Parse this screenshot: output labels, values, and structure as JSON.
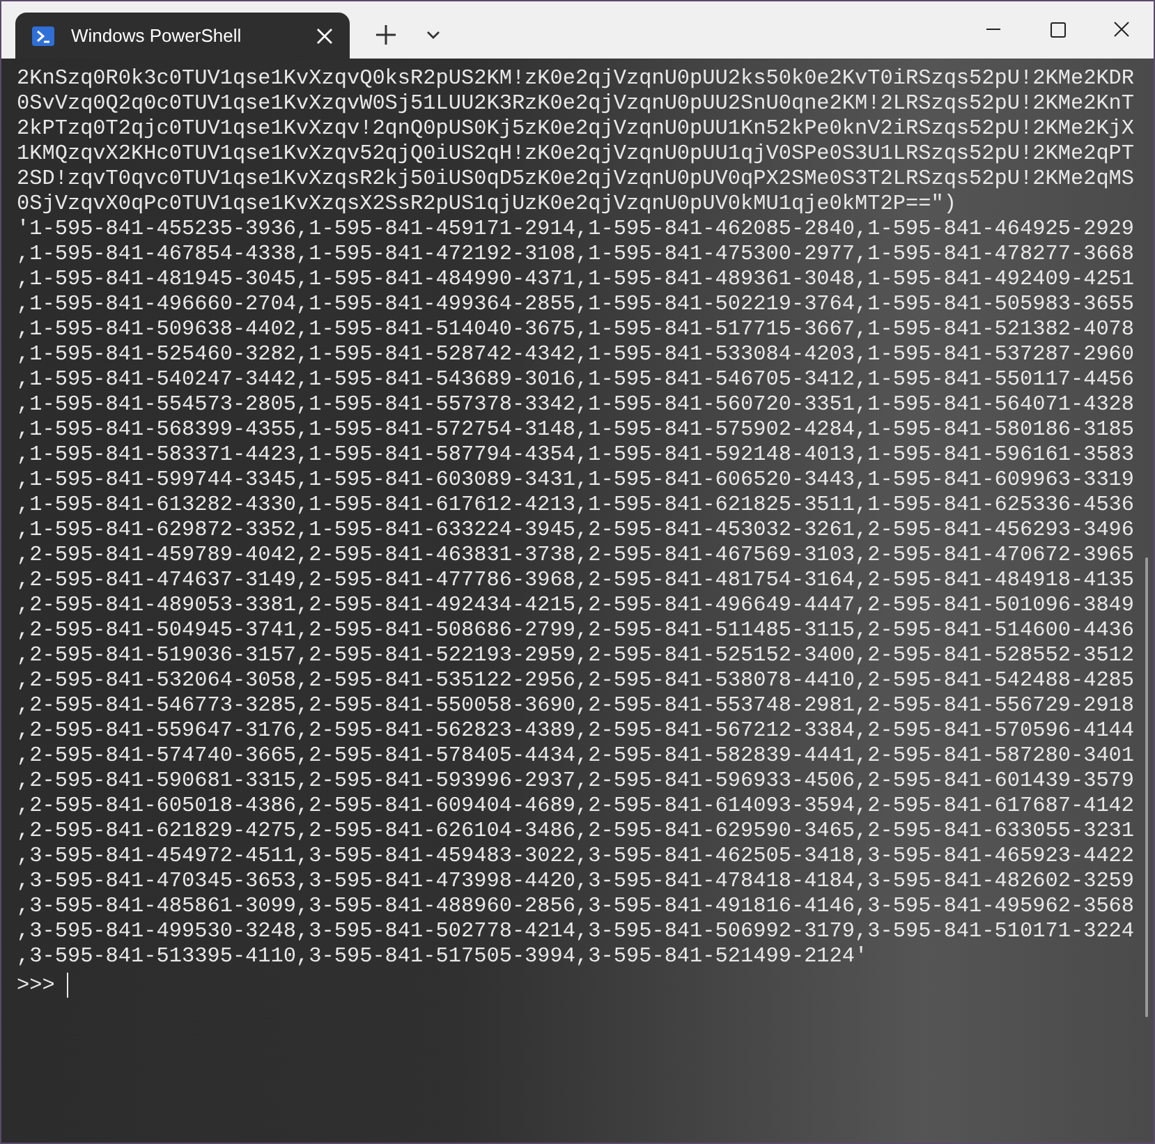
{
  "tab": {
    "title": "Windows PowerShell"
  },
  "terminal": {
    "lines": [
      "2KnSzq0R0k3c0TUV1qse1KvXzqvQ0ksR2pUS2KM!zK0e2qjVzqnU0pUU2ks50k0e2KvT0iRSzqs52pU!2KMe2KDR",
      "0SvVzq0Q2q0c0TUV1qse1KvXzqvW0Sj51LUU2K3RzK0e2qjVzqnU0pUU2SnU0qne2KM!2LRSzqs52pU!2KMe2KnT",
      "2kPTzq0T2qjc0TUV1qse1KvXzqv!2qnQ0pUS0Kj5zK0e2qjVzqnU0pUU1Kn52kPe0knV2iRSzqs52pU!2KMe2KjX",
      "1KMQzqvX2KHc0TUV1qse1KvXzqv52qjQ0iUS2qH!zK0e2qjVzqnU0pUU1qjV0SPe0S3U1LRSzqs52pU!2KMe2qPT",
      "2SD!zqvT0qvc0TUV1qse1KvXzqsR2kj50iUS0qD5zK0e2qjVzqnU0pUV0qPX2SMe0S3T2LRSzqs52pU!2KMe2qMS",
      "0SjVzqvX0qPc0TUV1qse1KvXzqsX2SsR2pUS1qjUzK0e2qjVzqnU0pUV0kMU1qje0kMT2P==\")",
      "'1-595-841-455235-3936,1-595-841-459171-2914,1-595-841-462085-2840,1-595-841-464925-2929",
      ",1-595-841-467854-4338,1-595-841-472192-3108,1-595-841-475300-2977,1-595-841-478277-3668",
      ",1-595-841-481945-3045,1-595-841-484990-4371,1-595-841-489361-3048,1-595-841-492409-4251",
      ",1-595-841-496660-2704,1-595-841-499364-2855,1-595-841-502219-3764,1-595-841-505983-3655",
      ",1-595-841-509638-4402,1-595-841-514040-3675,1-595-841-517715-3667,1-595-841-521382-4078",
      ",1-595-841-525460-3282,1-595-841-528742-4342,1-595-841-533084-4203,1-595-841-537287-2960",
      ",1-595-841-540247-3442,1-595-841-543689-3016,1-595-841-546705-3412,1-595-841-550117-4456",
      ",1-595-841-554573-2805,1-595-841-557378-3342,1-595-841-560720-3351,1-595-841-564071-4328",
      ",1-595-841-568399-4355,1-595-841-572754-3148,1-595-841-575902-4284,1-595-841-580186-3185",
      ",1-595-841-583371-4423,1-595-841-587794-4354,1-595-841-592148-4013,1-595-841-596161-3583",
      ",1-595-841-599744-3345,1-595-841-603089-3431,1-595-841-606520-3443,1-595-841-609963-3319",
      ",1-595-841-613282-4330,1-595-841-617612-4213,1-595-841-621825-3511,1-595-841-625336-4536",
      ",1-595-841-629872-3352,1-595-841-633224-3945,2-595-841-453032-3261,2-595-841-456293-3496",
      ",2-595-841-459789-4042,2-595-841-463831-3738,2-595-841-467569-3103,2-595-841-470672-3965",
      ",2-595-841-474637-3149,2-595-841-477786-3968,2-595-841-481754-3164,2-595-841-484918-4135",
      ",2-595-841-489053-3381,2-595-841-492434-4215,2-595-841-496649-4447,2-595-841-501096-3849",
      ",2-595-841-504945-3741,2-595-841-508686-2799,2-595-841-511485-3115,2-595-841-514600-4436",
      ",2-595-841-519036-3157,2-595-841-522193-2959,2-595-841-525152-3400,2-595-841-528552-3512",
      ",2-595-841-532064-3058,2-595-841-535122-2956,2-595-841-538078-4410,2-595-841-542488-4285",
      ",2-595-841-546773-3285,2-595-841-550058-3690,2-595-841-553748-2981,2-595-841-556729-2918",
      ",2-595-841-559647-3176,2-595-841-562823-4389,2-595-841-567212-3384,2-595-841-570596-4144",
      ",2-595-841-574740-3665,2-595-841-578405-4434,2-595-841-582839-4441,2-595-841-587280-3401",
      ",2-595-841-590681-3315,2-595-841-593996-2937,2-595-841-596933-4506,2-595-841-601439-3579",
      ",2-595-841-605018-4386,2-595-841-609404-4689,2-595-841-614093-3594,2-595-841-617687-4142",
      ",2-595-841-621829-4275,2-595-841-626104-3486,2-595-841-629590-3465,2-595-841-633055-3231",
      ",3-595-841-454972-4511,3-595-841-459483-3022,3-595-841-462505-3418,3-595-841-465923-4422",
      ",3-595-841-470345-3653,3-595-841-473998-4420,3-595-841-478418-4184,3-595-841-482602-3259",
      ",3-595-841-485861-3099,3-595-841-488960-2856,3-595-841-491816-4146,3-595-841-495962-3568",
      ",3-595-841-499530-3248,3-595-841-502778-4214,3-595-841-506992-3179,3-595-841-510171-3224",
      ",3-595-841-513395-4110,3-595-841-517505-3994,3-595-841-521499-2124'"
    ],
    "prompt": ">>>"
  }
}
